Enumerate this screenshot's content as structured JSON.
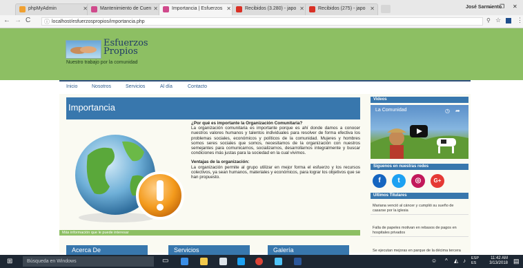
{
  "browser": {
    "tabs": [
      {
        "label": "phpMyAdmin",
        "color": "#f0a030"
      },
      {
        "label": "Mantenimiento de Cuen",
        "color": "#d04a8c"
      },
      {
        "label": "Importancia | Esfuerzos",
        "color": "#d04a8c"
      },
      {
        "label": "Recibidos (3.280) - japo",
        "color": "#d93025"
      },
      {
        "label": "Recibidos (275) - japo",
        "color": "#d93025"
      }
    ],
    "user": "José Sarmiento",
    "url": "localhost/esfuerzospropios/importancia.php"
  },
  "site": {
    "logo_line1": "Esfuerzos",
    "logo_line2": "Propios",
    "tagline": "Nuestro trabajo por la comunidad",
    "nav": [
      "Inicio",
      "Nosotros",
      "Servicios",
      "Al día",
      "Contacto"
    ],
    "page_title": "Importancia",
    "q_heading": "¿Por qué es importante la Organización Comunitaria?",
    "q_body": "La organización comunitaria es importante porque es ahí donde damos a conocer nuestros valores humanos y talentos individuales para resolver de forma efectiva los problemas sociales, económicos y políticos de la comunidad. Mujeres y hombres somos seres sociales que somos, necesitamos de la organización con nuestros semejantes para comunicarnos, socializarnos, desarrollarnos integralmente y buscar condiciones más justas para la sociedad en la cual vivimos.",
    "v_heading": "Ventajas de la organización:",
    "v_body": "La organización permite al grupo utilizar en mejor forma el esfuerzo y los recursos colectivos, ya sean humanos, materiales y económicos, para lograr los objetivos que se han propuesto.",
    "more_info": "Más información que le puede interesar",
    "cards": [
      "Acerca De",
      "Servicios",
      "Galería"
    ]
  },
  "sidebar": {
    "videos_heading": "Videos",
    "video_title": "La Comunidad",
    "social_heading": "Síguenos en nuestras redes",
    "social": [
      {
        "icon": "f",
        "name": "facebook-icon",
        "color": "#1565c0"
      },
      {
        "icon": "t",
        "name": "twitter-icon",
        "color": "#1da1f2"
      },
      {
        "icon": "◎",
        "name": "instagram-icon",
        "color": "#c2185b"
      },
      {
        "icon": "G+",
        "name": "google-plus-icon",
        "color": "#e53935"
      }
    ],
    "news_heading": "Últimos Titulares",
    "news": [
      "Mariana venció al cáncer y cumplió su sueño de casarse por la iglesia",
      "Falla de papeles motivan en rebasos de pagos en hospitales privados",
      "Se ejecutan mejoras en parque de la décima tercera"
    ]
  },
  "taskbar": {
    "search_placeholder": "Búsqueda en Windows",
    "lang1": "ESP",
    "lang2": "ES",
    "time": "11:42 AM",
    "date": "3/13/2018"
  }
}
